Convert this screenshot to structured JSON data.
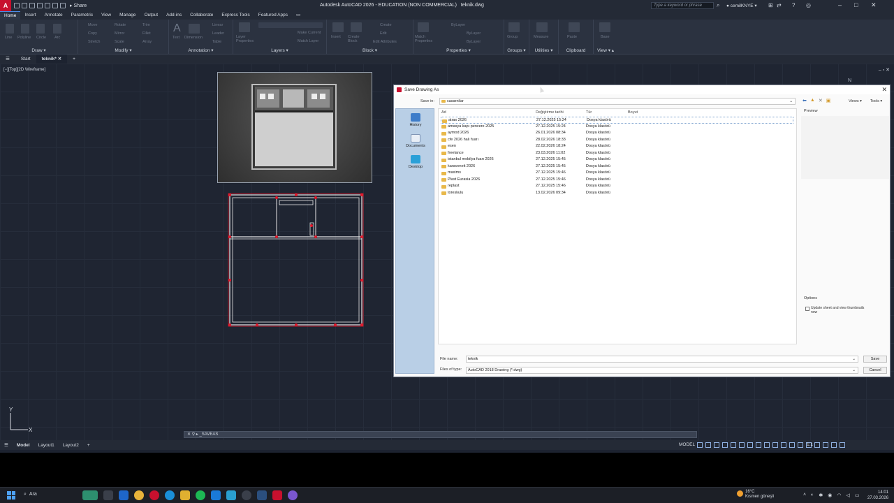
{
  "titlebar": {
    "title": "Autodesk AutoCAD 2026 - EDUCATION (NON COMMERCIAL)",
    "filename": "teknik.dwg",
    "share": "Share",
    "search_placeholder": "Type a keyword or phrase",
    "user": "cemilKNYE",
    "logo": "A"
  },
  "menu_tabs": [
    "Home",
    "Insert",
    "Annotate",
    "Parametric",
    "View",
    "Manage",
    "Output",
    "Add-ins",
    "Collaborate",
    "Express Tools",
    "Featured Apps"
  ],
  "ribbon_panels": [
    "Draw",
    "Modify",
    "Annotation",
    "Layers",
    "Block",
    "Properties",
    "Groups",
    "Utilities",
    "Clipboard",
    "View"
  ],
  "ribbon_ghost": {
    "draw": [
      "Line",
      "Polyline",
      "Circle",
      "Arc"
    ],
    "modify": [
      "Move",
      "Rotate",
      "Trim",
      "Copy",
      "Mirror",
      "Fillet",
      "Stretch",
      "Scale",
      "Array"
    ],
    "annotation": [
      "Text",
      "Dimension",
      "Linear",
      "Leader",
      "Table"
    ],
    "layers": [
      "Layer Properties",
      "Make Current",
      "Match Layer"
    ],
    "block": [
      "Insert",
      "Create Block",
      "Create",
      "Edit",
      "Edit Attributes"
    ],
    "properties": [
      "Match Properties",
      "ByLayer",
      "ByLayer",
      "ByLayer"
    ],
    "groups": [
      "Group"
    ],
    "utilities": [
      "Measure"
    ],
    "clipboard": [
      "Paste"
    ],
    "view": [
      "Base"
    ]
  },
  "doc_tabs": [
    "Start",
    "teknik*"
  ],
  "viewport": {
    "label": "[−][Top][2D Wireframe]",
    "compass": "N",
    "ucs_x": "X",
    "ucs_y": "Y"
  },
  "command_line": "_SAVEAS",
  "layout_tabs": [
    "Model",
    "Layout1",
    "Layout2"
  ],
  "status": {
    "model": "MODEL",
    "scale": "1:1"
  },
  "dialog": {
    "title": "Save Drawing As",
    "save_in_label": "Save in:",
    "save_in_value": "casarnilar",
    "views_label": "Views",
    "tools_label": "Tools",
    "places": [
      "History",
      "Documents",
      "Desktop"
    ],
    "columns": [
      "Ad",
      "Değiştirme tarihi",
      "Tür",
      "Boyut"
    ],
    "files": [
      {
        "name": "atrax 2026",
        "date": "27.12.2025 15:24",
        "type": "Dosya klasörü"
      },
      {
        "name": "amasya kapı pencere 2025",
        "date": "27.12.2025 15:24",
        "type": "Dosya klasörü"
      },
      {
        "name": "aymod 2026",
        "date": "26.01.2026 08:34",
        "type": "Dosya klasörü"
      },
      {
        "name": "cfe 2026 halı fuarı",
        "date": "28.02.2026 18:33",
        "type": "Dosya klasörü"
      },
      {
        "name": "esen",
        "date": "22.02.2026 18:24",
        "type": "Dosya klasörü"
      },
      {
        "name": "freelance",
        "date": "23.03.2026 11:02",
        "type": "Dosya klasörü"
      },
      {
        "name": "istanbul mobilya fuarı 2026",
        "date": "27.12.2025 15:45",
        "type": "Dosya klasörü"
      },
      {
        "name": "karavoneit 2026",
        "date": "27.12.2025 15:45",
        "type": "Dosya klasörü"
      },
      {
        "name": "maxims",
        "date": "27.12.2025 15:46",
        "type": "Dosya klasörü"
      },
      {
        "name": "Plast Eurasia 2026",
        "date": "27.12.2025 15:46",
        "type": "Dosya klasörü"
      },
      {
        "name": "replast",
        "date": "27.12.2025 15:46",
        "type": "Dosya klasörü"
      },
      {
        "name": "toreskulu",
        "date": "13.02.2026 09:34",
        "type": "Dosya klasörü"
      }
    ],
    "preview_label": "Preview",
    "options_label": "Options",
    "update_thumbnails": "Update sheet and view thumbnails now",
    "file_name_label": "File name:",
    "file_name_value": "teknik",
    "file_type_label": "Files of type:",
    "file_type_value": "AutoCAD 2018 Drawing (*.dwg)",
    "save_button": "Save",
    "cancel_button": "Cancel"
  },
  "taskbar": {
    "search": "Ara",
    "weather_temp": "16°C",
    "weather_desc": "Kısmen güneşli",
    "time": "14:01",
    "date": "27.03.2026"
  }
}
